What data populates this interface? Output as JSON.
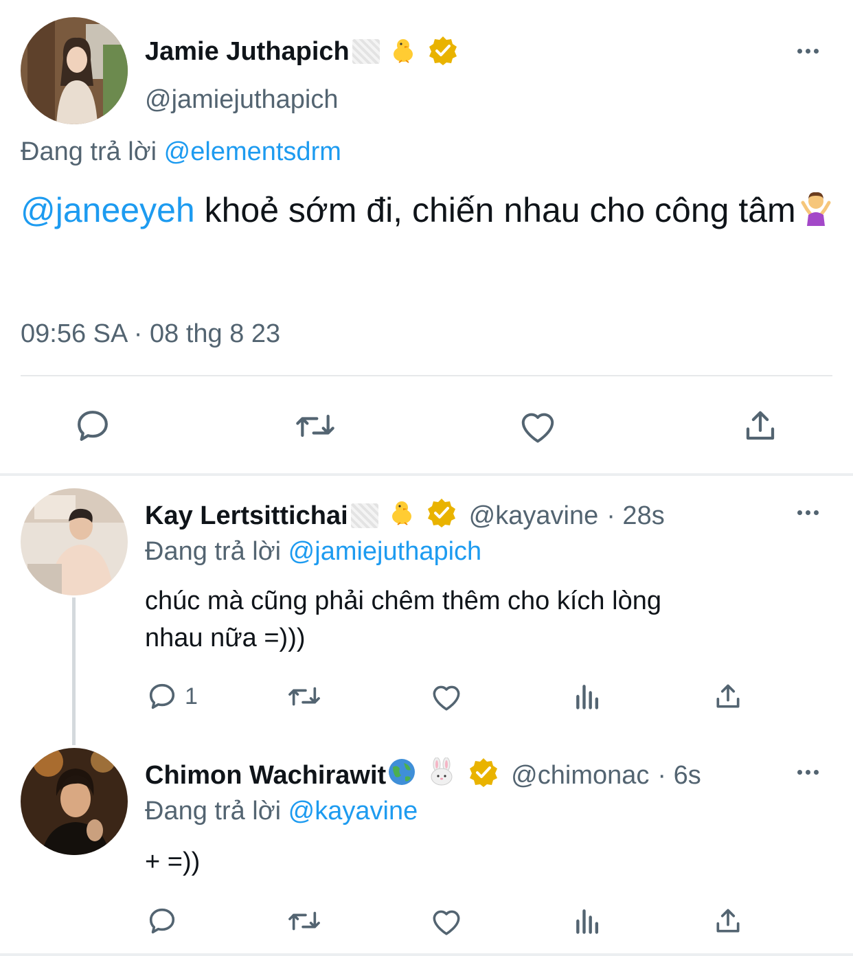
{
  "main_tweet": {
    "display_name": "Jamie Juthapich",
    "handle": "@jamiejuthapich",
    "reply_prefix": "Đang trả lời",
    "reply_to": "@elementsdrm",
    "mention": "@janeeyeh",
    "text": " khoẻ sớm đi, chiến nhau cho công tâm",
    "timestamp": "09:56 SA · 08 thg 8 23"
  },
  "replies": [
    {
      "display_name": "Kay Lertsittichai",
      "handle": "@kayavine",
      "time": "· 28s",
      "reply_prefix": "Đang trả lời",
      "reply_to": "@jamiejuthapich",
      "text_line1": "chúc mà cũng phải chêm thêm cho kích lòng",
      "text_line2": "nhau nữa =)))",
      "reply_count": "1"
    },
    {
      "display_name": "Chimon Wachirawit",
      "handle": "@chimonac",
      "time": "· 6s",
      "reply_prefix": "Đang trả lời",
      "reply_to": "@kayavine",
      "text": "+ =))",
      "reply_count": ""
    }
  ],
  "colors": {
    "link": "#1d9bf0",
    "muted": "#536471",
    "verified_badge": "#e9b300",
    "text": "#0f1419"
  },
  "icons": [
    "more-icon",
    "verified-badge-icon",
    "chick-emoji",
    "globe-emoji",
    "rabbit-emoji",
    "shrug-emoji",
    "reply-icon",
    "retweet-icon",
    "like-icon",
    "views-icon",
    "share-icon"
  ]
}
